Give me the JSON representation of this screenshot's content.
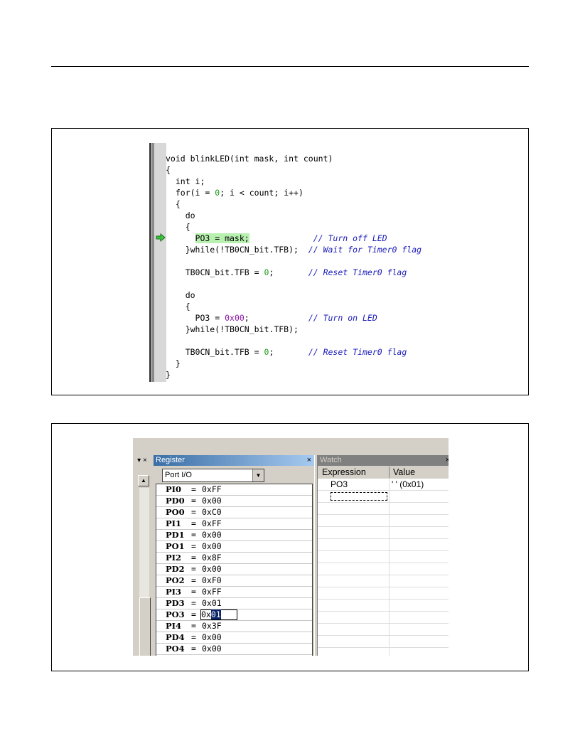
{
  "code_editor": {
    "lines": [
      {
        "segments": [
          {
            "t": "void blinkLED(int mask, int count)"
          }
        ]
      },
      {
        "segments": [
          {
            "t": "{"
          }
        ]
      },
      {
        "segments": [
          {
            "t": "  int i;"
          }
        ]
      },
      {
        "segments": [
          {
            "t": "  for(i = "
          },
          {
            "t": "0",
            "c": "num"
          },
          {
            "t": "; i < count; i++)"
          }
        ]
      },
      {
        "segments": [
          {
            "t": "  {"
          }
        ]
      },
      {
        "segments": [
          {
            "t": "    do"
          }
        ]
      },
      {
        "segments": [
          {
            "t": "    {"
          }
        ]
      },
      {
        "segments": [
          {
            "t": "      "
          },
          {
            "t": "PO3 = mask;",
            "c": "hl"
          },
          {
            "t": "             "
          },
          {
            "t": "// Turn off LED",
            "c": "cmt"
          }
        ]
      },
      {
        "segments": [
          {
            "t": "    }while(!TB0CN_bit.TFB);  "
          },
          {
            "t": "// Wait for Timer0 flag",
            "c": "cmt"
          }
        ]
      },
      {
        "segments": [
          {
            "t": ""
          }
        ]
      },
      {
        "segments": [
          {
            "t": "    TB0CN_bit.TFB = "
          },
          {
            "t": "0",
            "c": "num"
          },
          {
            "t": ";       "
          },
          {
            "t": "// Reset Timer0 flag",
            "c": "cmt"
          }
        ]
      },
      {
        "segments": [
          {
            "t": ""
          }
        ]
      },
      {
        "segments": [
          {
            "t": "    do"
          }
        ]
      },
      {
        "segments": [
          {
            "t": "    {"
          }
        ]
      },
      {
        "segments": [
          {
            "t": "      PO3 = "
          },
          {
            "t": "0x00",
            "c": "hex"
          },
          {
            "t": ";            "
          },
          {
            "t": "// Turn on LED",
            "c": "cmt"
          }
        ]
      },
      {
        "segments": [
          {
            "t": "    }while(!TB0CN_bit.TFB);"
          }
        ]
      },
      {
        "segments": [
          {
            "t": ""
          }
        ]
      },
      {
        "segments": [
          {
            "t": "    TB0CN_bit.TFB = "
          },
          {
            "t": "0",
            "c": "num"
          },
          {
            "t": ";       "
          },
          {
            "t": "// Reset Timer0 flag",
            "c": "cmt"
          }
        ]
      },
      {
        "segments": [
          {
            "t": "  }"
          }
        ]
      },
      {
        "segments": [
          {
            "t": "}"
          }
        ]
      }
    ],
    "current_line_index": 7
  },
  "left_strip": {
    "toolbar_glyphs": "▾ ×"
  },
  "register_panel": {
    "title": "Register",
    "close": "×",
    "selected_group": "Port I/O",
    "registers": [
      {
        "name": "PI0",
        "value": "0xFF"
      },
      {
        "name": "PD0",
        "value": "0x00"
      },
      {
        "name": "PO0",
        "value": "0xC0"
      },
      {
        "name": "PI1",
        "value": "0xFF"
      },
      {
        "name": "PD1",
        "value": "0x00"
      },
      {
        "name": "PO1",
        "value": "0x00"
      },
      {
        "name": "PI2",
        "value": "0x8F"
      },
      {
        "name": "PD2",
        "value": "0x00"
      },
      {
        "name": "PO2",
        "value": "0xF0"
      },
      {
        "name": "PI3",
        "value": "0xFF"
      },
      {
        "name": "PD3",
        "value": "0x01"
      },
      {
        "name": "PO3",
        "value": "0x01",
        "editing": true,
        "edit_prefix": "0x",
        "edit_selected": "01"
      },
      {
        "name": "PI4",
        "value": "0x3F"
      },
      {
        "name": "PD4",
        "value": "0x00"
      },
      {
        "name": "PO4",
        "value": "0x00"
      }
    ]
  },
  "watch_panel": {
    "title": "Watch",
    "close": "×",
    "columns": [
      "Expression",
      "Value"
    ],
    "rows": [
      {
        "expression": "PO3",
        "value": "'   ' (0x01)"
      }
    ]
  }
}
